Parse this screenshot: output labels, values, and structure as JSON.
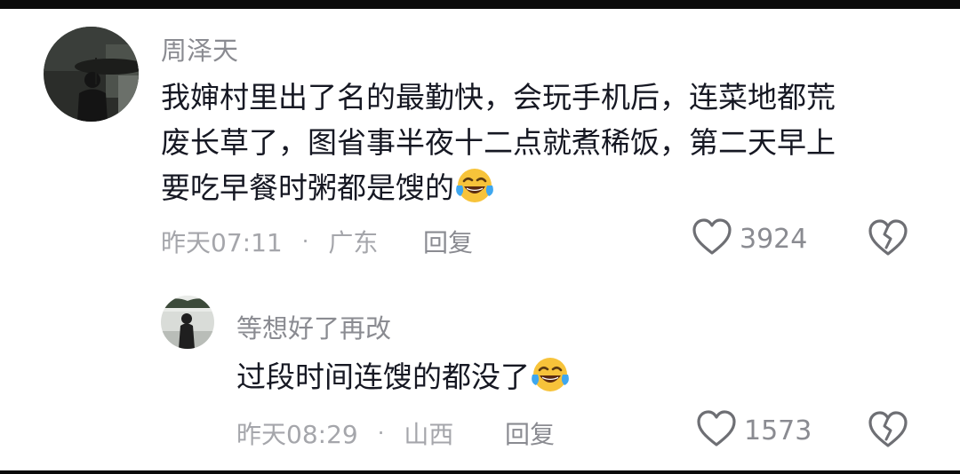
{
  "comments": [
    {
      "username": "周泽天",
      "lines": [
        "我婶村里出了名的最勤快，会玩手机后，连菜地都荒",
        "废长草了，图省事半夜十二点就煮稀饭，第二天早上",
        "要吃早餐时粥都是馊的"
      ],
      "emoji": "laughing-crying-emoji",
      "time": "昨天07:11",
      "location": "广东",
      "reply_label": "回复",
      "likes": "3924",
      "icons": {
        "like": "heart-outline-icon",
        "dislike": "broken-heart-icon"
      }
    },
    {
      "username": "等想好了再改",
      "lines": [
        "过段时间连馊的都没了"
      ],
      "emoji": "laughing-crying-emoji",
      "time": "昨天08:29",
      "location": "山西",
      "reply_label": "回复",
      "likes": "1573",
      "icons": {
        "like": "heart-outline-icon",
        "dislike": "broken-heart-icon"
      }
    }
  ],
  "separator": "·",
  "colors": {
    "text": "#161823",
    "secondary": "#8a8b91",
    "meta": "#a5a6ab",
    "emoji_face": "#f7c33a"
  }
}
